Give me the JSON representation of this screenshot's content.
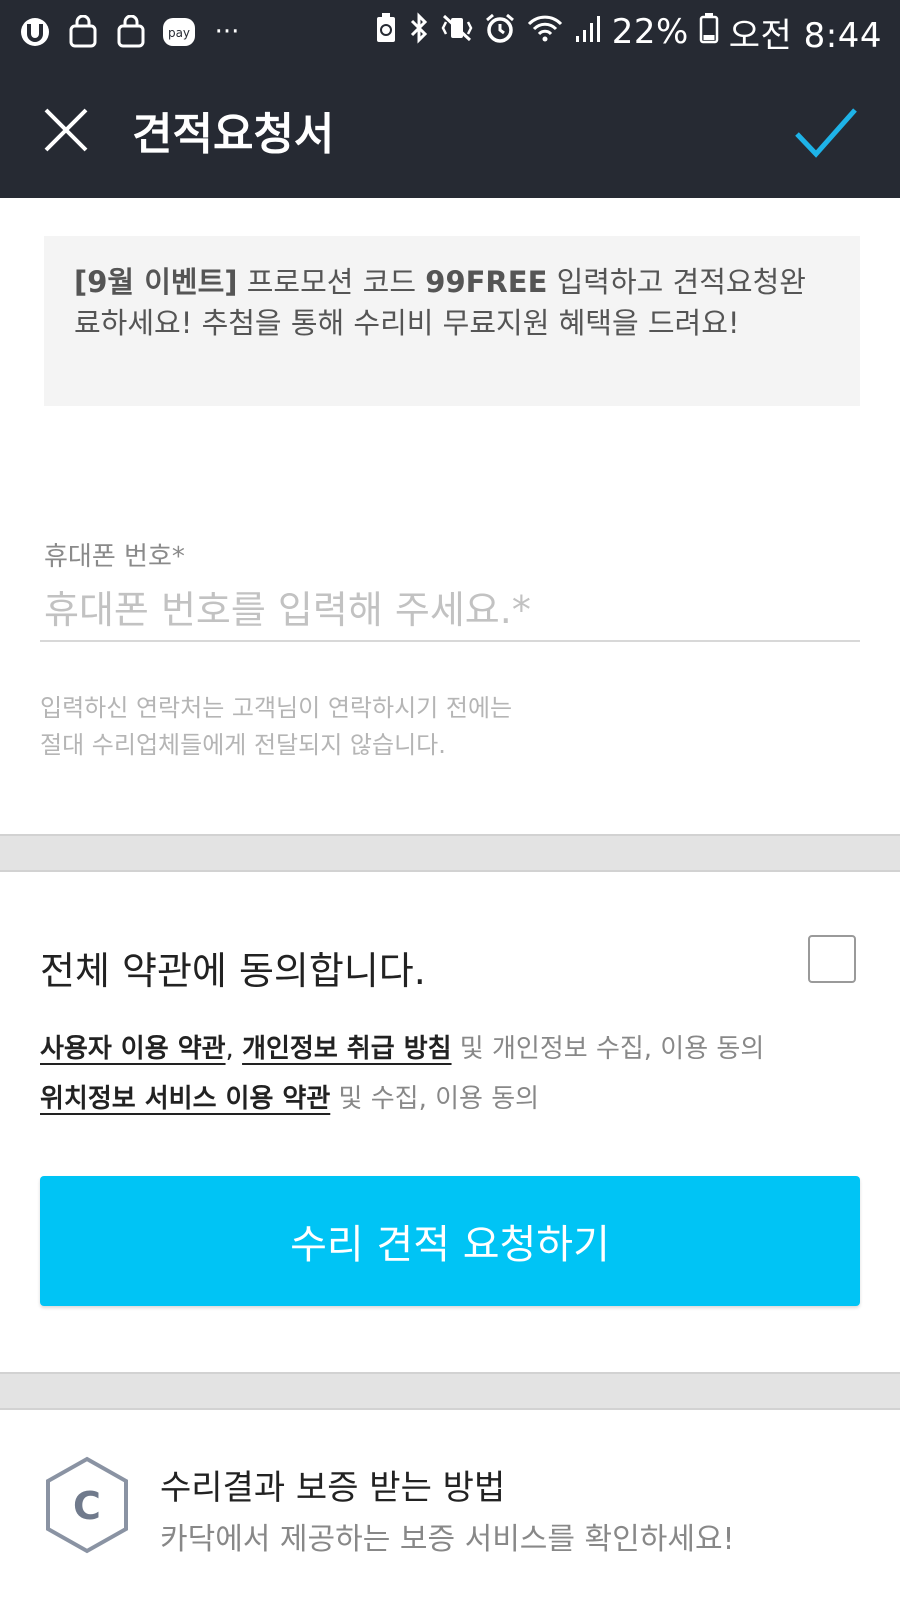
{
  "status_bar": {
    "battery_percent": "22%",
    "time": "오전 8:44",
    "left_icons": [
      "u-plus-icon",
      "shopping-bag-icon",
      "shopping-bag-icon",
      "pay-icon",
      "more-dots-icon"
    ],
    "pay_label": "pay",
    "more_label": "···",
    "right_icons": [
      "recycle-battery-icon",
      "bluetooth-icon",
      "vibrate-mute-icon",
      "alarm-icon",
      "wifi-icon",
      "signal-icon",
      "battery-icon"
    ]
  },
  "app_bar": {
    "title": "견적요청서",
    "close_icon": "close-icon",
    "confirm_icon": "check-icon",
    "background": "#262a33",
    "check_color": "#1eb3e8"
  },
  "promo": {
    "bold_prefix": "[9월 이벤트]",
    "text_1": " 프로모션 코드 ",
    "code": "99FREE",
    "text_2": " 입력하고 견적요청완료하세요! 추첨을 통해 수리비 무료지원 혜택을 드려요!"
  },
  "phone": {
    "label": "휴대폰 번호*",
    "placeholder": "휴대폰 번호를 입력해 주세요.*",
    "value": "",
    "note_line1": "입력하신 연락처는 고객님이 연락하시기 전에는",
    "note_line2": "절대 수리업체들에게 전달되지 않습니다."
  },
  "terms": {
    "agree_all": "전체 약관에 동의합니다.",
    "agree_checked": false,
    "link_user_terms": "사용자 이용 약관",
    "comma": ",",
    "link_privacy": "개인정보 취급 방침",
    "line1_suffix": " 및 개인정보 수집, 이용 동의",
    "link_location": "위치정보 서비스 이용 약관",
    "line2_suffix": " 및 수집, 이용 동의"
  },
  "submit": {
    "label": "수리 견적 요청하기",
    "color": "#00c4f5"
  },
  "warranty": {
    "icon": "hexagon-c-icon",
    "icon_letter": "C",
    "title": "수리결과 보증 받는 방법",
    "subtitle": "카닥에서 제공하는 보증 서비스를 확인하세요!"
  }
}
